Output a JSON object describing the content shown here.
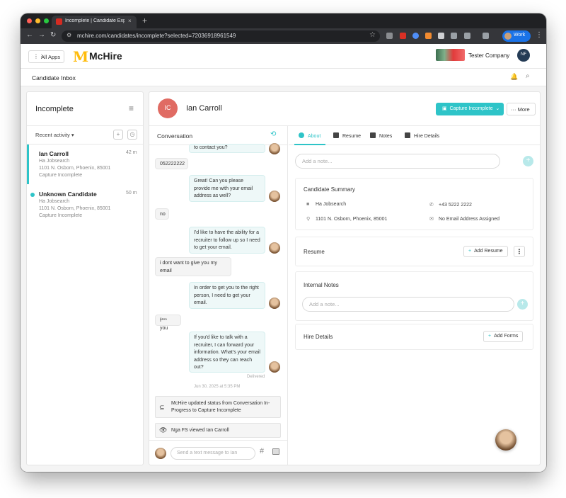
{
  "browser": {
    "tab_title": "Incomplete | Candidate Exper",
    "tab_close": "×",
    "new_tab": "+",
    "url": "mchire.com/candidates/incomplete?selected=72036918961549",
    "profile_label": "Work"
  },
  "app": {
    "all_apps_label": "All Apps",
    "logo_mark": "M",
    "logo_text": "McHire",
    "company_name": "Tester Company",
    "user_initials": "NF",
    "page_title": "Candidate Inbox"
  },
  "left_panel": {
    "title": "Incomplete",
    "sort_label": "Recent activity ▾",
    "add_icon": "+",
    "clock_icon": "◷",
    "candidates": [
      {
        "name": "Ian Carroll",
        "time": "42 m",
        "source": "Ha Jobsearch",
        "address": "1101 N. Osborn, Phoenix, 85001",
        "status": "Capture Incomplete"
      },
      {
        "name": "Unknown Candidate",
        "time": "50 m",
        "source": "Ha Jobsearch",
        "address": "1101 N. Osborn, Phoenix, 85001",
        "status": "Capture Incomplete"
      }
    ]
  },
  "main": {
    "initials": "IC",
    "name": "Ian Carroll",
    "capture_button": "Capture Incomplete",
    "more_button": "More"
  },
  "conversation": {
    "title": "Conversation",
    "messages": [
      {
        "dir": "out",
        "text": "to contact you?"
      },
      {
        "dir": "in",
        "text": "052222222"
      },
      {
        "dir": "out",
        "text": "Great! Can you please provide me with your email address as well?"
      },
      {
        "dir": "in",
        "text": "no"
      },
      {
        "dir": "out",
        "text": "I'd like to have the ability for a recruiter to follow up so I need to get your email."
      },
      {
        "dir": "in",
        "text": "i dont want to give you my email"
      },
      {
        "dir": "out",
        "text": "In order to get you to the right person, I need to get your email."
      },
      {
        "dir": "in",
        "text": "f*** you"
      },
      {
        "dir": "out",
        "text": "If you'd like to talk with a recruiter, I can forward your information. What's your email address so they can reach out?"
      }
    ],
    "delivered": "Delivered",
    "timestamp": "Jun 30, 2025 at 5:35 PM",
    "event_status": "McHire updated status from Conversation In-Progress to Capture Incomplete",
    "event_viewed": "Nga FS viewed Ian Carroll",
    "composer_placeholder": "Send a text message to Ian"
  },
  "details": {
    "tabs": [
      "About",
      "Resume",
      "Notes",
      "Hire Details"
    ],
    "add_note_placeholder": "Add a note...",
    "summary_title": "Candidate Summary",
    "source": "Ha Jobsearch",
    "phone": "+43 5222 2222",
    "address": "1101 N. Osborn, Phoenix, 85001",
    "email": "No Email Address Assigned",
    "resume_title": "Resume",
    "add_resume": "Add Resume",
    "internal_notes_title": "Internal Notes",
    "internal_note_placeholder": "Add a note...",
    "hire_details_title": "Hire Details",
    "add_forms": "Add Forms"
  },
  "colors": {
    "accent": "#2ec4c8",
    "avatar_ic": "#e06b63",
    "brand_yellow": "#ffbc0d"
  }
}
